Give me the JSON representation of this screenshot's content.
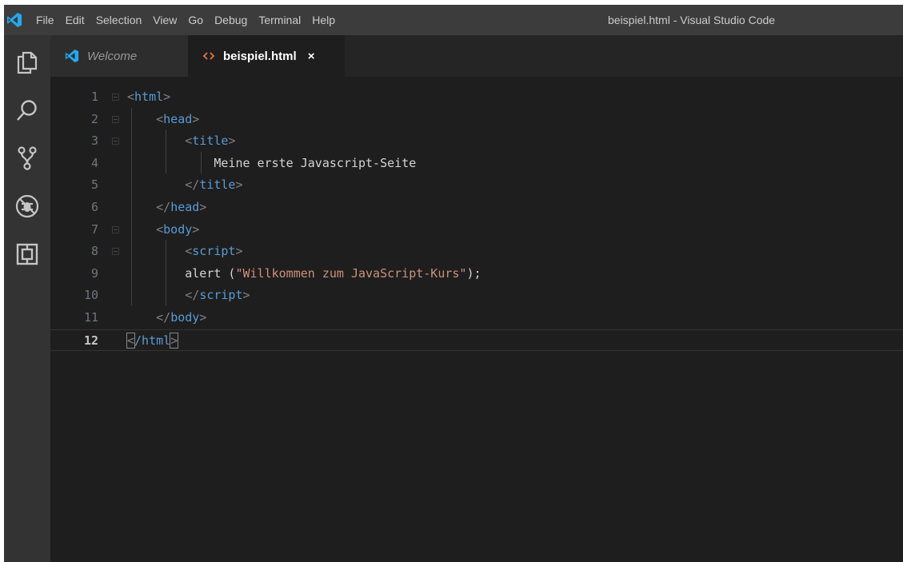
{
  "app": {
    "window_title": "beispiel.html - Visual Studio Code",
    "menu": [
      "File",
      "Edit",
      "Selection",
      "View",
      "Go",
      "Debug",
      "Terminal",
      "Help"
    ]
  },
  "activitybar": {
    "icons": [
      "explorer-icon",
      "search-icon",
      "source-control-icon",
      "debug-icon",
      "extensions-icon"
    ]
  },
  "tabs": [
    {
      "label": "Welcome",
      "icon": "vscode-logo-icon",
      "active": false
    },
    {
      "label": "beispiel.html",
      "icon": "html-file-icon",
      "active": true,
      "close": "×"
    }
  ],
  "editor": {
    "active_line": 12,
    "lines": [
      {
        "num": "1",
        "indent": "",
        "open": "<",
        "tag": "html",
        "close": ">",
        "text": ""
      },
      {
        "num": "2",
        "indent": "    ",
        "open": "<",
        "tag": "head",
        "close": ">",
        "text": ""
      },
      {
        "num": "3",
        "indent": "        ",
        "open": "<",
        "tag": "title",
        "close": ">",
        "text": ""
      },
      {
        "num": "4",
        "indent": "            ",
        "open": "",
        "tag": "",
        "close": "",
        "text": "Meine erste Javascript-Seite"
      },
      {
        "num": "5",
        "indent": "        ",
        "open": "</",
        "tag": "title",
        "close": ">",
        "text": ""
      },
      {
        "num": "6",
        "indent": "    ",
        "open": "</",
        "tag": "head",
        "close": ">",
        "text": ""
      },
      {
        "num": "7",
        "indent": "    ",
        "open": "<",
        "tag": "body",
        "close": ">",
        "text": ""
      },
      {
        "num": "8",
        "indent": "        ",
        "open": "<",
        "tag": "script",
        "close": ">",
        "text": ""
      },
      {
        "num": "9",
        "indent": "        ",
        "code_pre": "alert (",
        "string": "\"Willkommen zum JavaScript-Kurs\"",
        "code_post": ");"
      },
      {
        "num": "10",
        "indent": "        ",
        "open": "</",
        "tag": "script",
        "close": ">",
        "text": ""
      },
      {
        "num": "11",
        "indent": "    ",
        "open": "</",
        "tag": "body",
        "close": ">",
        "text": ""
      },
      {
        "num": "12",
        "indent": "",
        "open": "<",
        "tag": "/html",
        "close": ">",
        "text": ""
      }
    ]
  },
  "colors": {
    "tag": "#569cd6",
    "bracket": "#808080",
    "string": "#ce9178",
    "text": "#d4d4d4",
    "editor_bg": "#1e1e1e",
    "accent": "#23a9f2"
  }
}
